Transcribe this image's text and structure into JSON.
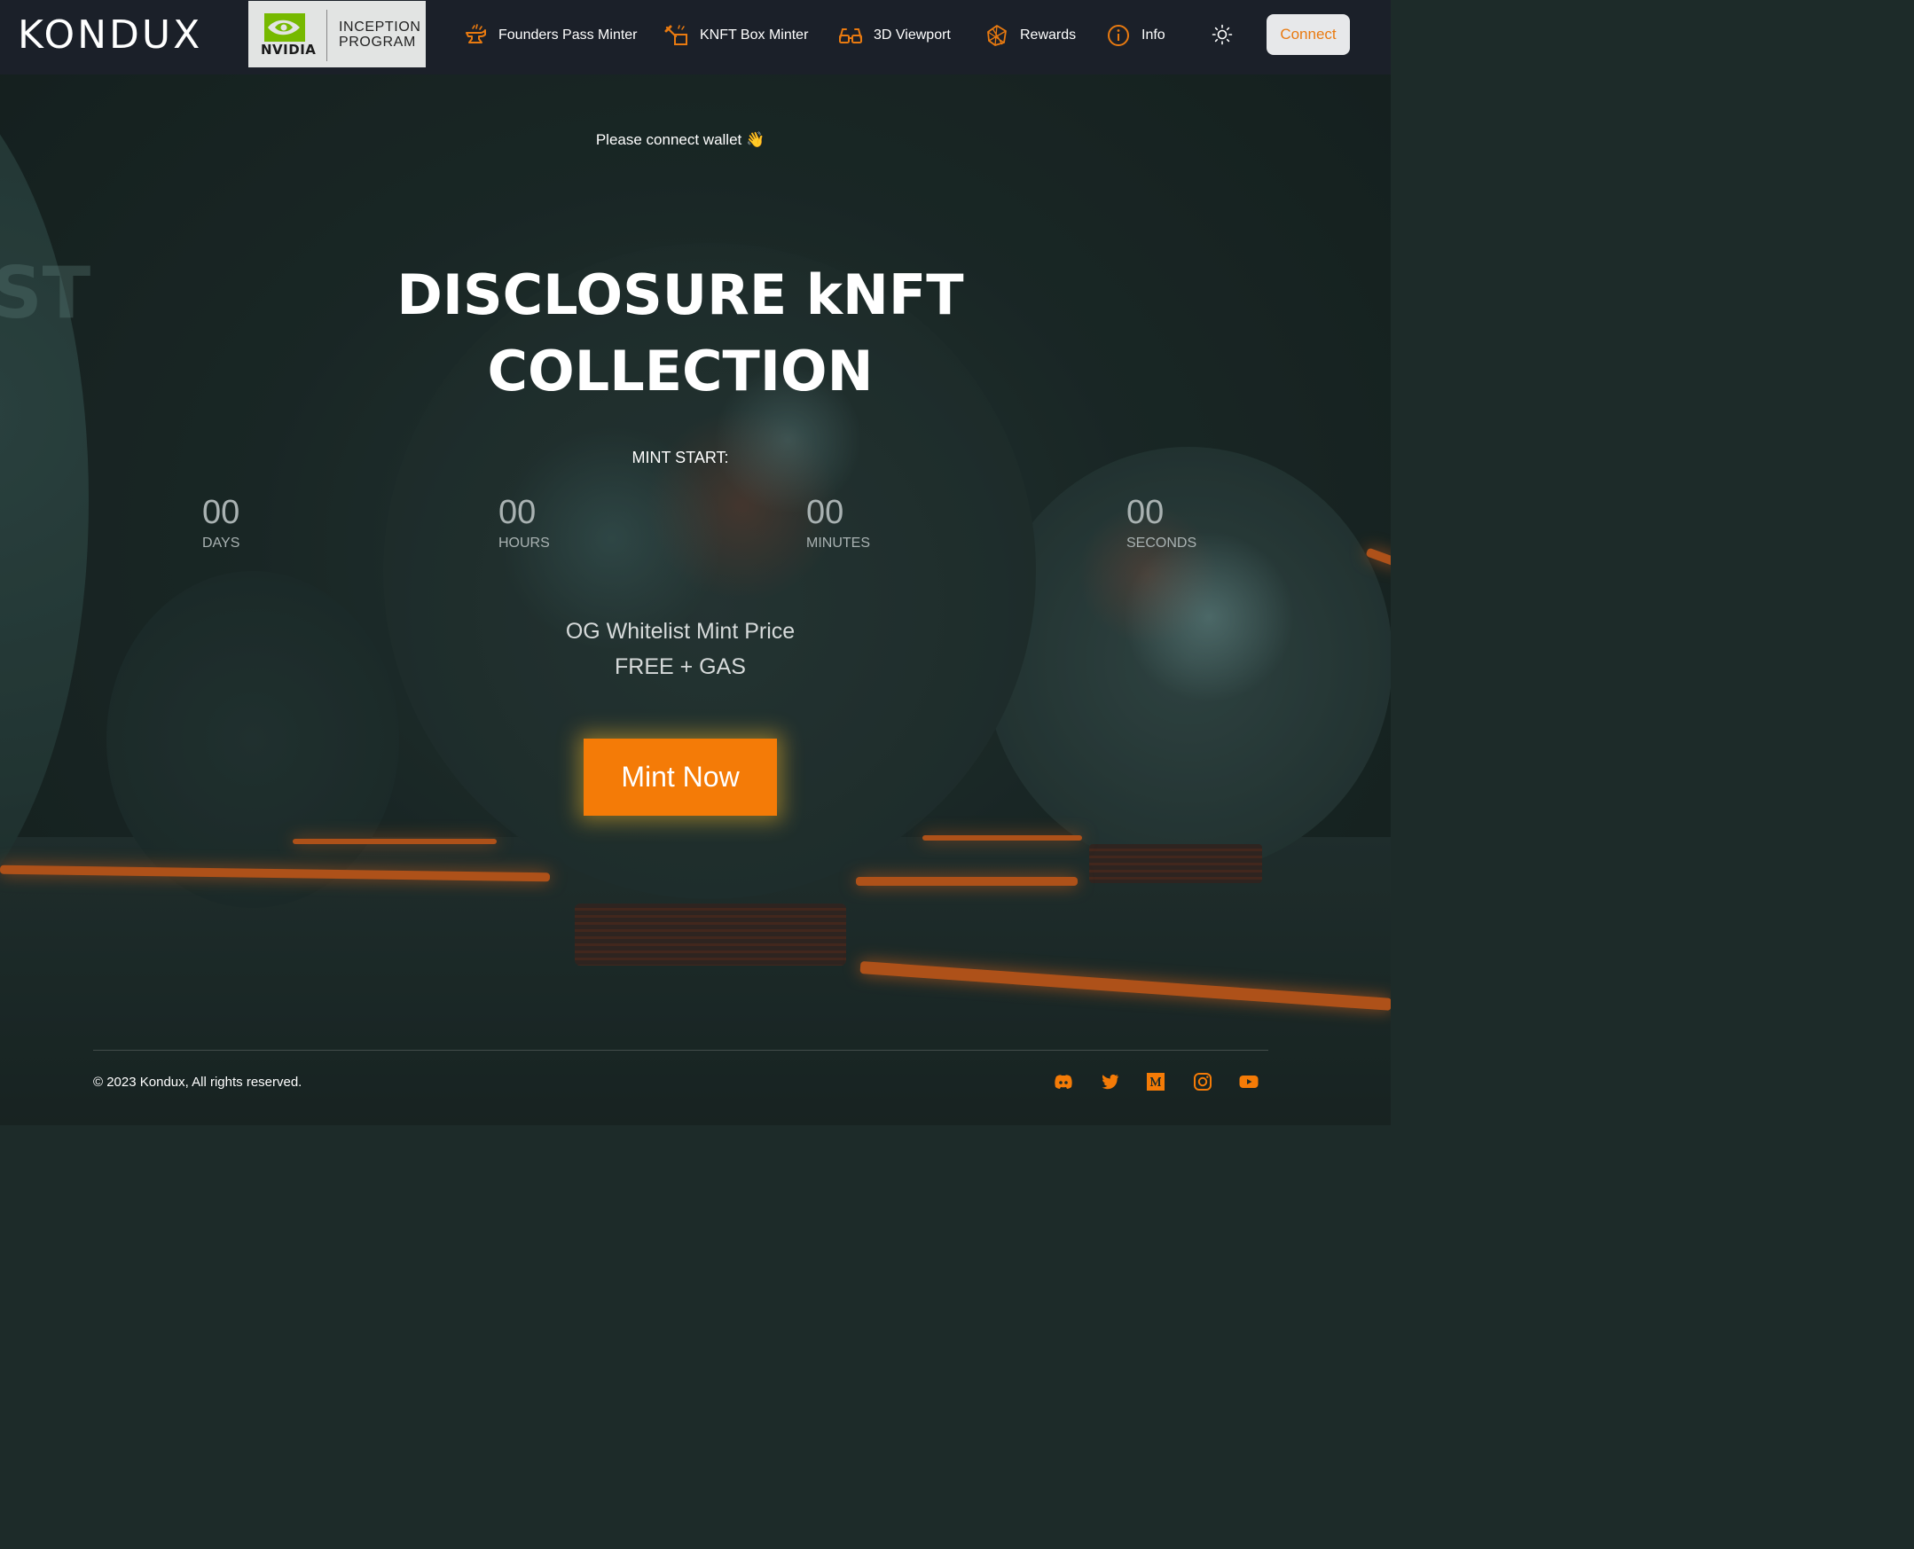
{
  "brand": {
    "logo_text": "KONDUX",
    "partner_word": "NVIDIA",
    "partner_program_line1": "INCEPTION",
    "partner_program_line2": "PROGRAM"
  },
  "nav": {
    "items": [
      {
        "label": "Founders Pass Minter",
        "icon": "anvil-icon"
      },
      {
        "label": "KNFT Box Minter",
        "icon": "box-minter-icon"
      },
      {
        "label": "3D Viewport",
        "icon": "3d-glasses-icon"
      },
      {
        "label": "Rewards",
        "icon": "rewards-icon"
      },
      {
        "label": "Info",
        "icon": "info-icon"
      }
    ],
    "theme_icon": "sun-icon",
    "connect_label": "Connect"
  },
  "hero": {
    "wallet_message": "Please connect wallet 👋",
    "title_line1": "DISCLOSURE kNFT",
    "title_line2": "COLLECTION",
    "mint_start_label": "MINT START:",
    "countdown": [
      {
        "value": "00",
        "unit": "DAYS"
      },
      {
        "value": "00",
        "unit": "HOURS"
      },
      {
        "value": "00",
        "unit": "MINUTES"
      },
      {
        "value": "00",
        "unit": "SECONDS"
      }
    ],
    "price_label": "OG Whitelist Mint Price",
    "price_value": "FREE + GAS",
    "mint_button_label": "Mint Now",
    "background_text": "ST"
  },
  "footer": {
    "copyright": "© 2023 Kondux, All rights reserved.",
    "social_icons": [
      "discord-icon",
      "twitter-icon",
      "medium-icon",
      "instagram-icon",
      "youtube-icon"
    ]
  },
  "colors": {
    "accent": "#f47b07",
    "header_bg": "#1b2029",
    "nvidia_green": "#76b900"
  }
}
